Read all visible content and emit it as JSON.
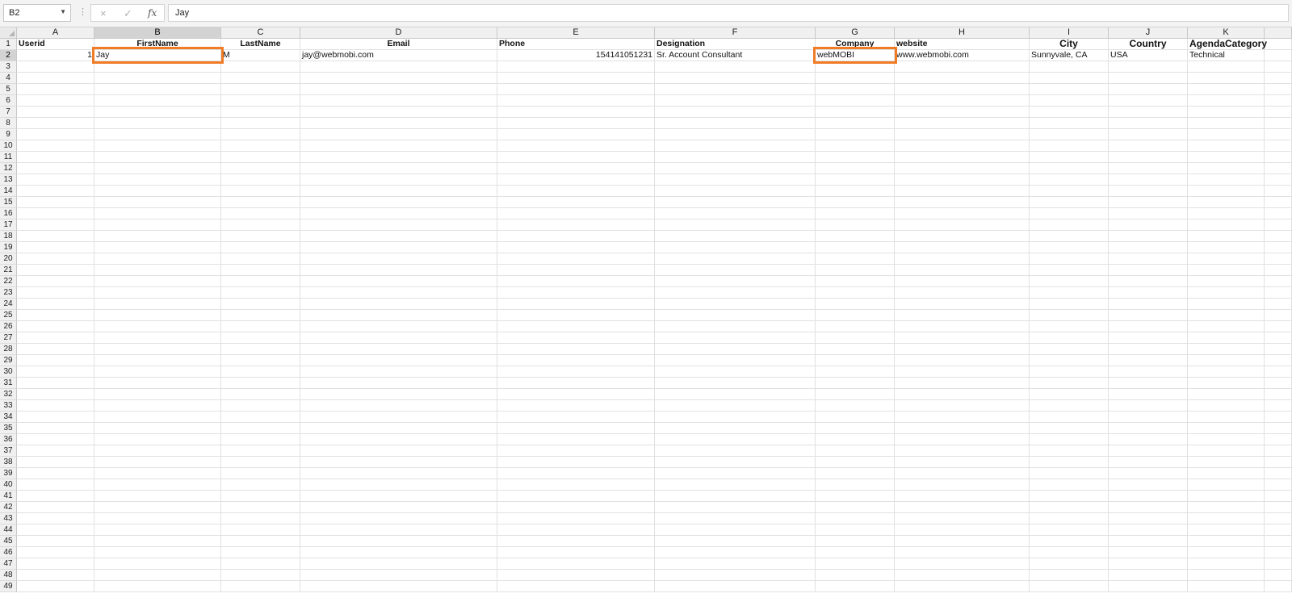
{
  "formula_bar": {
    "name_box": "B2",
    "dots": "⋮",
    "cancel_icon": "×",
    "enter_icon": "✓",
    "fx_label": "fx",
    "value": "Jay"
  },
  "columns": [
    "A",
    "B",
    "C",
    "D",
    "E",
    "F",
    "G",
    "H",
    "I",
    "J",
    "K"
  ],
  "row_count": 49,
  "header_row": {
    "A": "Userid",
    "B": "FirstName",
    "C": "LastName",
    "D": "Email",
    "E": "Phone",
    "F": "Designation",
    "G": "Company",
    "H": "website",
    "I": "City",
    "J": "Country",
    "K": "AgendaCategory"
  },
  "data_row": {
    "A": "1",
    "B": "Jay",
    "C": "M",
    "D": "jay@webmobi.com",
    "E": "154141051231",
    "F": "Sr. Account Consultant",
    "G": "webMOBI",
    "H": "www.webmobi.com",
    "I": "Sunnyvale, CA",
    "J": "USA",
    "K": "Technical"
  },
  "selected_cell": "B2",
  "highlighted_cells": [
    "B2",
    "G2"
  ],
  "colors": {
    "highlight": "#f07c26",
    "grid_line": "#e1e1e1",
    "header_bg": "#f0f0f0"
  }
}
